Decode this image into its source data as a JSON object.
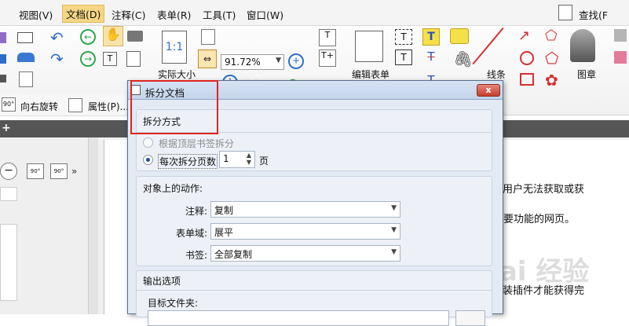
{
  "menubar": {
    "items": [
      "视图(V)",
      "文档(D)",
      "注释(C)",
      "表单(R)",
      "工具(T)",
      "窗口(W)"
    ],
    "find_label": "查找(F"
  },
  "ribbon": {
    "zoom_value": "91.72%",
    "zoom_in_label": "放大",
    "actual_size_label": "实际大小",
    "edit_form_label": "编辑表单",
    "line_label": "线条",
    "stamp_label": "图章",
    "rotate_right_label": "向右旋转",
    "properties_label": "属性(P)..."
  },
  "document": {
    "line1": "值用户无法获取或获",
    "line2": "要功能的网页。",
    "line3": "安装插件才能获得完"
  },
  "watermark": "Bai 经验",
  "dialog": {
    "title": "拆分文档",
    "close": "x",
    "split_method": {
      "header": "拆分方式",
      "option_bookmark": "根据顶层书签拆分",
      "option_pages": "每次拆分页数",
      "pages_value": "1",
      "pages_unit": "页"
    },
    "actions": {
      "header": "对象上的动作:",
      "annotation_label": "注释:",
      "annotation_value": "复制",
      "form_field_label": "表单域:",
      "form_field_value": "展平",
      "bookmark_label": "书签:",
      "bookmark_value": "全部复制"
    },
    "output": {
      "header": "输出选项",
      "target_folder_label": "目标文件夹:"
    }
  },
  "colors": {
    "highlight_box": "#e0261f",
    "active_menu": "#f5d684",
    "dialog_bg": "#e4eaf3"
  }
}
